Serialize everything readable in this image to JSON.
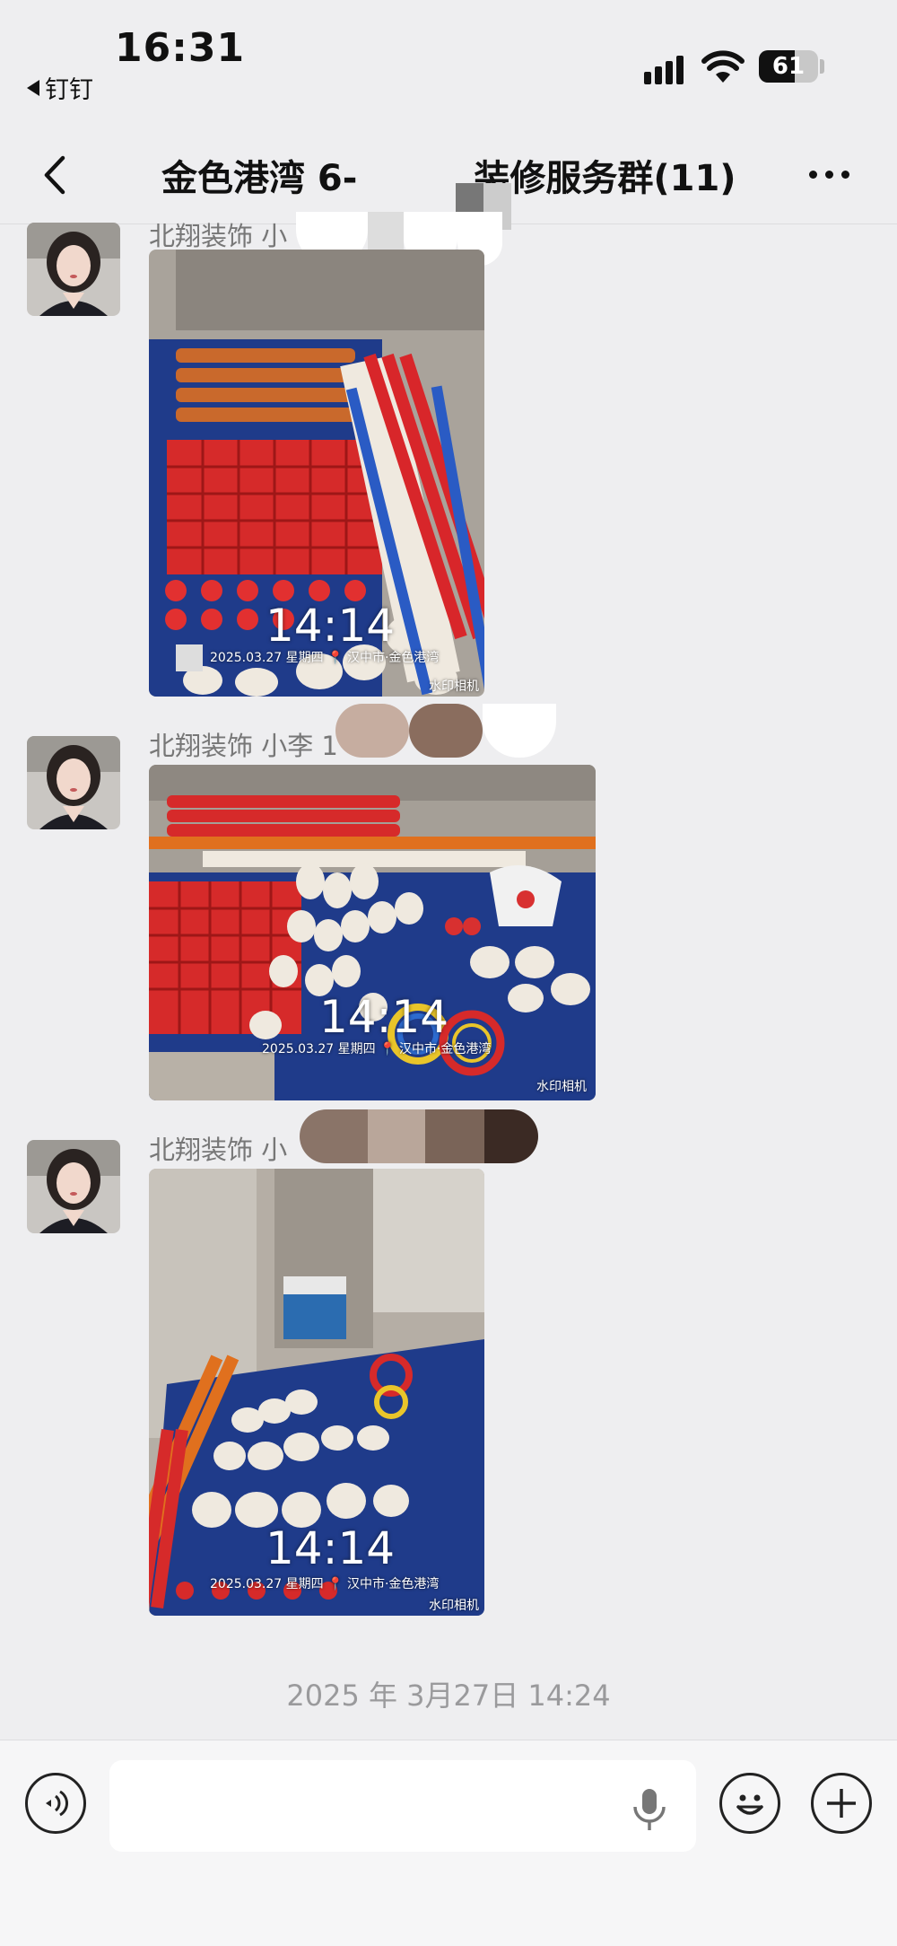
{
  "status_bar": {
    "time": "16:31",
    "back_app_label": "钉钉",
    "battery_percent": "61",
    "battery_level": 0.61
  },
  "header": {
    "title_left": "金色港湾 6-",
    "title_right": "装修服务群(11)"
  },
  "messages": [
    {
      "sender": "北翔装饰 小",
      "photo": {
        "time_stamp": "14:14",
        "date_line": "2025.03.27 星期四 📍 汉中市·金色港湾",
        "brand": "水印相机"
      }
    },
    {
      "sender": "北翔装饰 小李 1",
      "photo": {
        "time_stamp": "14:14",
        "date_line": "2025.03.27 星期四 📍 汉中市·金色港湾",
        "brand": "水印相机"
      }
    },
    {
      "sender": "北翔装饰 小",
      "photo": {
        "time_stamp": "14:14",
        "date_line": "2025.03.27 星期四 📍 汉中市·金色港湾",
        "brand": "水印相机"
      }
    }
  ],
  "timestamp": "2025 年 3月27日 14:24",
  "input_bar": {
    "placeholder": ""
  },
  "icons": [
    "voice-toggle-icon",
    "microphone-icon",
    "emoji-icon",
    "plus-icon",
    "back-chevron-icon",
    "more-icon",
    "wifi-icon",
    "signal-icon",
    "battery-icon"
  ]
}
